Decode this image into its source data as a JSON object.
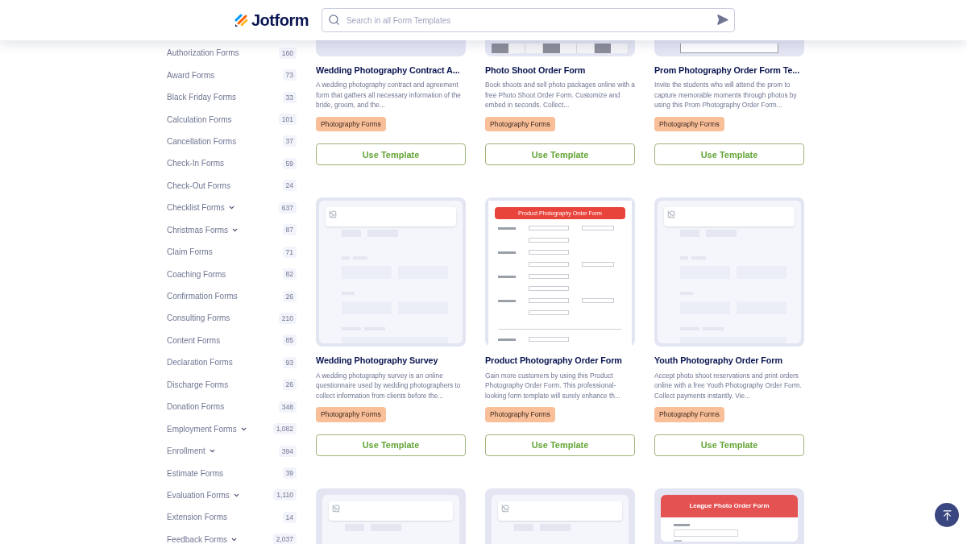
{
  "header": {
    "logo": "Jotform",
    "search": {
      "placeholder": "Search in all Form Templates"
    }
  },
  "sidebar": {
    "items": [
      {
        "label": "Authorization Forms",
        "count": "160",
        "has_submenu": false
      },
      {
        "label": "Award Forms",
        "count": "73",
        "has_submenu": false
      },
      {
        "label": "Black Friday Forms",
        "count": "33",
        "has_submenu": false
      },
      {
        "label": "Calculation Forms",
        "count": "101",
        "has_submenu": false
      },
      {
        "label": "Cancellation Forms",
        "count": "37",
        "has_submenu": false
      },
      {
        "label": "Check-In Forms",
        "count": "59",
        "has_submenu": false
      },
      {
        "label": "Check-Out Forms",
        "count": "24",
        "has_submenu": false
      },
      {
        "label": "Checklist Forms",
        "count": "637",
        "has_submenu": true
      },
      {
        "label": "Christmas Forms",
        "count": "87",
        "has_submenu": true
      },
      {
        "label": "Claim Forms",
        "count": "71",
        "has_submenu": false
      },
      {
        "label": "Coaching Forms",
        "count": "82",
        "has_submenu": false
      },
      {
        "label": "Confirmation Forms",
        "count": "26",
        "has_submenu": false
      },
      {
        "label": "Consulting Forms",
        "count": "210",
        "has_submenu": false
      },
      {
        "label": "Content Forms",
        "count": "85",
        "has_submenu": false
      },
      {
        "label": "Declaration Forms",
        "count": "93",
        "has_submenu": false
      },
      {
        "label": "Discharge Forms",
        "count": "26",
        "has_submenu": false
      },
      {
        "label": "Donation Forms",
        "count": "348",
        "has_submenu": false
      },
      {
        "label": "Employment Forms",
        "count": "1,082",
        "has_submenu": true
      },
      {
        "label": "Enrollment",
        "count": "394",
        "has_submenu": true
      },
      {
        "label": "Estimate Forms",
        "count": "39",
        "has_submenu": false
      },
      {
        "label": "Evaluation Forms",
        "count": "1,110",
        "has_submenu": true
      },
      {
        "label": "Extension Forms",
        "count": "14",
        "has_submenu": false
      },
      {
        "label": "Feedback Forms",
        "count": "2,037",
        "has_submenu": true
      }
    ]
  },
  "templates": [
    {
      "thumbnail": {
        "kind": "skeleton"
      },
      "title": "Wedding Photography Contract A...",
      "description": "A wedding photography contract and agreement form that gathers all necessary information of the bride, groom, and the...",
      "tag": "Photography Forms",
      "button": "Use Template"
    },
    {
      "thumbnail": {
        "kind": "table"
      },
      "title": "Photo Shoot Order Form",
      "description": "Book shoots and sell photo packages online with a free Photo Shoot Order Form. Customize and embed in seconds. Collect...",
      "tag": "Photography Forms",
      "button": "Use Template"
    },
    {
      "thumbnail": {
        "kind": "sheet"
      },
      "title": "Prom Photography Order Form Te...",
      "description": "Invite the students who will attend the prom to capture memorable moments through photos by using this Prom Photography Order Form...",
      "tag": "Photography Forms",
      "button": "Use Template"
    },
    {
      "thumbnail": {
        "kind": "skeleton"
      },
      "title": "Wedding Photography Survey",
      "description": "A wedding photography survey is an online questionnaire used by wedding photographers to collect information from clients before the...",
      "tag": "Photography Forms",
      "button": "Use Template"
    },
    {
      "thumbnail": {
        "kind": "form",
        "heading": "Product Photography Order Form"
      },
      "title": "Product Photography Order Form",
      "description": "Gain more customers by using this Product Photography Order Form. This professional-looking form template will surely enhance th...",
      "tag": "Photography Forms",
      "button": "Use Template"
    },
    {
      "thumbnail": {
        "kind": "skeleton"
      },
      "title": "Youth Photography Order Form",
      "description": "Accept photo shoot reservations and print orders online with a free Youth Photography Order Form. Collect payments instantly. Vie...",
      "tag": "Photography Forms",
      "button": "Use Template"
    },
    {
      "thumbnail": {
        "kind": "skeleton"
      }
    },
    {
      "thumbnail": {
        "kind": "skeleton"
      }
    },
    {
      "thumbnail": {
        "kind": "form",
        "heading": "League Photo Order Form"
      }
    }
  ]
}
